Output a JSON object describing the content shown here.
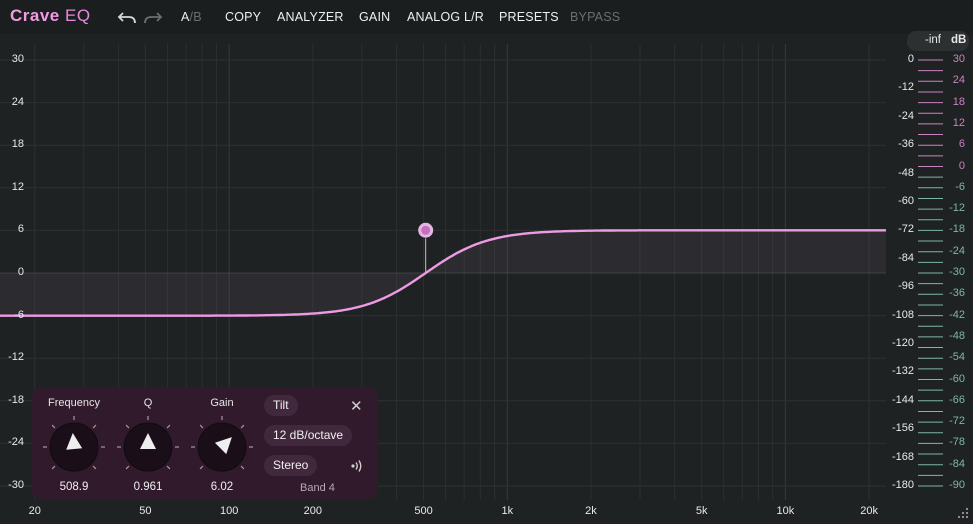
{
  "app": {
    "name_a": "Crave",
    "name_b": "EQ"
  },
  "toolbar": {
    "undo_icon": "undo-arrow-icon",
    "redo_icon": "redo-arrow-icon",
    "ab_a": "A",
    "ab_sep": "/",
    "ab_b": "B",
    "copy": "COPY",
    "analyzer": "ANALYZER",
    "gain": "GAIN",
    "analog": "ANALOG L/R",
    "presets": "PRESETS",
    "bypass": "BYPASS"
  },
  "graph": {
    "y_labels": [
      "30",
      "24",
      "18",
      "12",
      "6",
      "0",
      "-6",
      "-12",
      "-18",
      "-24",
      "-30"
    ],
    "x_labels": [
      "20",
      "50",
      "100",
      "200",
      "500",
      "1k",
      "2k",
      "5k",
      "10k",
      "20k"
    ],
    "curve_color": "#ee9be6",
    "node_color": "#c46fbf"
  },
  "meter": {
    "level": "-inf",
    "unit": "dB",
    "left_labels": [
      "0",
      "-12",
      "-24",
      "-36",
      "-48",
      "-60",
      "-72",
      "-84",
      "-96",
      "-108",
      "-120",
      "-132",
      "-144",
      "-156",
      "-168",
      "-180"
    ],
    "right_labels": [
      "30",
      "24",
      "18",
      "12",
      "6",
      "0",
      "-6",
      "-12",
      "-18",
      "-24",
      "-30",
      "-36",
      "-42",
      "-48",
      "-54",
      "-60",
      "-66",
      "-72",
      "-78",
      "-84",
      "-90"
    ],
    "pink_color": "#c982c0",
    "green_color": "#7fb7a2"
  },
  "band": {
    "frequency_label": "Frequency",
    "frequency_value": "508.9",
    "q_label": "Q",
    "q_value": "0.961",
    "gain_label": "Gain",
    "gain_value": "6.02",
    "type": "Tilt",
    "slope": "12 dB/octave",
    "channel": "Stereo",
    "name": "Band 4",
    "close_icon": "close-icon",
    "speaker_icon": "speaker-solo-icon"
  }
}
